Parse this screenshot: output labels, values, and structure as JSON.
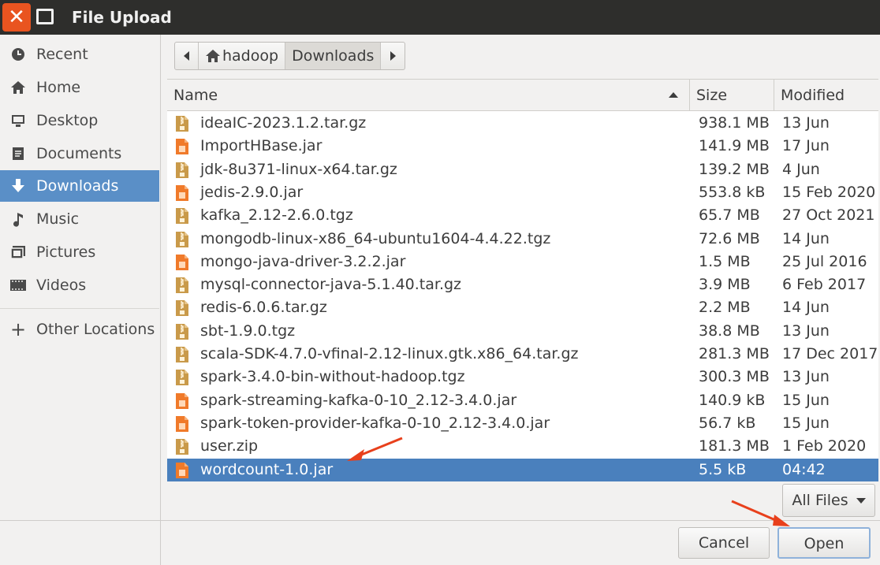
{
  "window": {
    "title": "File Upload",
    "close_icon": "close-icon",
    "maximize_icon": "maximize-icon",
    "accent": "#e95420"
  },
  "sidebar": {
    "items": [
      {
        "label": "Recent",
        "icon": "clock-icon"
      },
      {
        "label": "Home",
        "icon": "home-icon"
      },
      {
        "label": "Desktop",
        "icon": "desktop-icon"
      },
      {
        "label": "Documents",
        "icon": "documents-icon"
      },
      {
        "label": "Downloads",
        "icon": "download-arrow-icon",
        "active": true
      },
      {
        "label": "Music",
        "icon": "music-note-icon"
      },
      {
        "label": "Pictures",
        "icon": "pictures-icon"
      },
      {
        "label": "Videos",
        "icon": "film-icon"
      },
      {
        "label": "Other Locations",
        "icon": "plus-icon"
      }
    ],
    "active_color": "#5a8fc7"
  },
  "pathbar": {
    "back_icon": "chevron-left-icon",
    "forward_icon": "chevron-right-icon",
    "segments": [
      "hadoop",
      "Downloads"
    ],
    "home_icon": "home-icon"
  },
  "columns": {
    "name": "Name",
    "size": "Size",
    "modified": "Modified"
  },
  "files": [
    {
      "name": "ideaIC-2023.1.2.tar.gz",
      "size": "938.1 MB",
      "modified": "13 Jun",
      "type": "archive"
    },
    {
      "name": "ImportHBase.jar",
      "size": "141.9 MB",
      "modified": "17 Jun",
      "type": "jar"
    },
    {
      "name": "jdk-8u371-linux-x64.tar.gz",
      "size": "139.2 MB",
      "modified": "4 Jun",
      "type": "archive"
    },
    {
      "name": "jedis-2.9.0.jar",
      "size": "553.8 kB",
      "modified": "15 Feb 2020",
      "type": "jar"
    },
    {
      "name": "kafka_2.12-2.6.0.tgz",
      "size": "65.7 MB",
      "modified": "27 Oct 2021",
      "type": "archive"
    },
    {
      "name": "mongodb-linux-x86_64-ubuntu1604-4.4.22.tgz",
      "size": "72.6 MB",
      "modified": "14 Jun",
      "type": "archive"
    },
    {
      "name": "mongo-java-driver-3.2.2.jar",
      "size": "1.5 MB",
      "modified": "25 Jul 2016",
      "type": "jar"
    },
    {
      "name": "mysql-connector-java-5.1.40.tar.gz",
      "size": "3.9 MB",
      "modified": "6 Feb 2017",
      "type": "archive"
    },
    {
      "name": "redis-6.0.6.tar.gz",
      "size": "2.2 MB",
      "modified": "14 Jun",
      "type": "archive"
    },
    {
      "name": "sbt-1.9.0.tgz",
      "size": "38.8 MB",
      "modified": "13 Jun",
      "type": "archive"
    },
    {
      "name": "scala-SDK-4.7.0-vfinal-2.12-linux.gtk.x86_64.tar.gz",
      "size": "281.3 MB",
      "modified": "17 Dec 2017",
      "type": "archive"
    },
    {
      "name": "spark-3.4.0-bin-without-hadoop.tgz",
      "size": "300.3 MB",
      "modified": "13 Jun",
      "type": "archive"
    },
    {
      "name": "spark-streaming-kafka-0-10_2.12-3.4.0.jar",
      "size": "140.9 kB",
      "modified": "15 Jun",
      "type": "jar"
    },
    {
      "name": "spark-token-provider-kafka-0-10_2.12-3.4.0.jar",
      "size": "56.7 kB",
      "modified": "15 Jun",
      "type": "jar"
    },
    {
      "name": "user.zip",
      "size": "181.3 MB",
      "modified": "1 Feb 2020",
      "type": "archive"
    },
    {
      "name": "wordcount-1.0.jar",
      "size": "5.5 kB",
      "modified": "04:42",
      "type": "jar",
      "selected": true
    }
  ],
  "selection_color": "#4a80bd",
  "filter": {
    "label": "All Files"
  },
  "buttons": {
    "cancel": "Cancel",
    "open": "Open"
  },
  "annotation_color": "#e8401c"
}
